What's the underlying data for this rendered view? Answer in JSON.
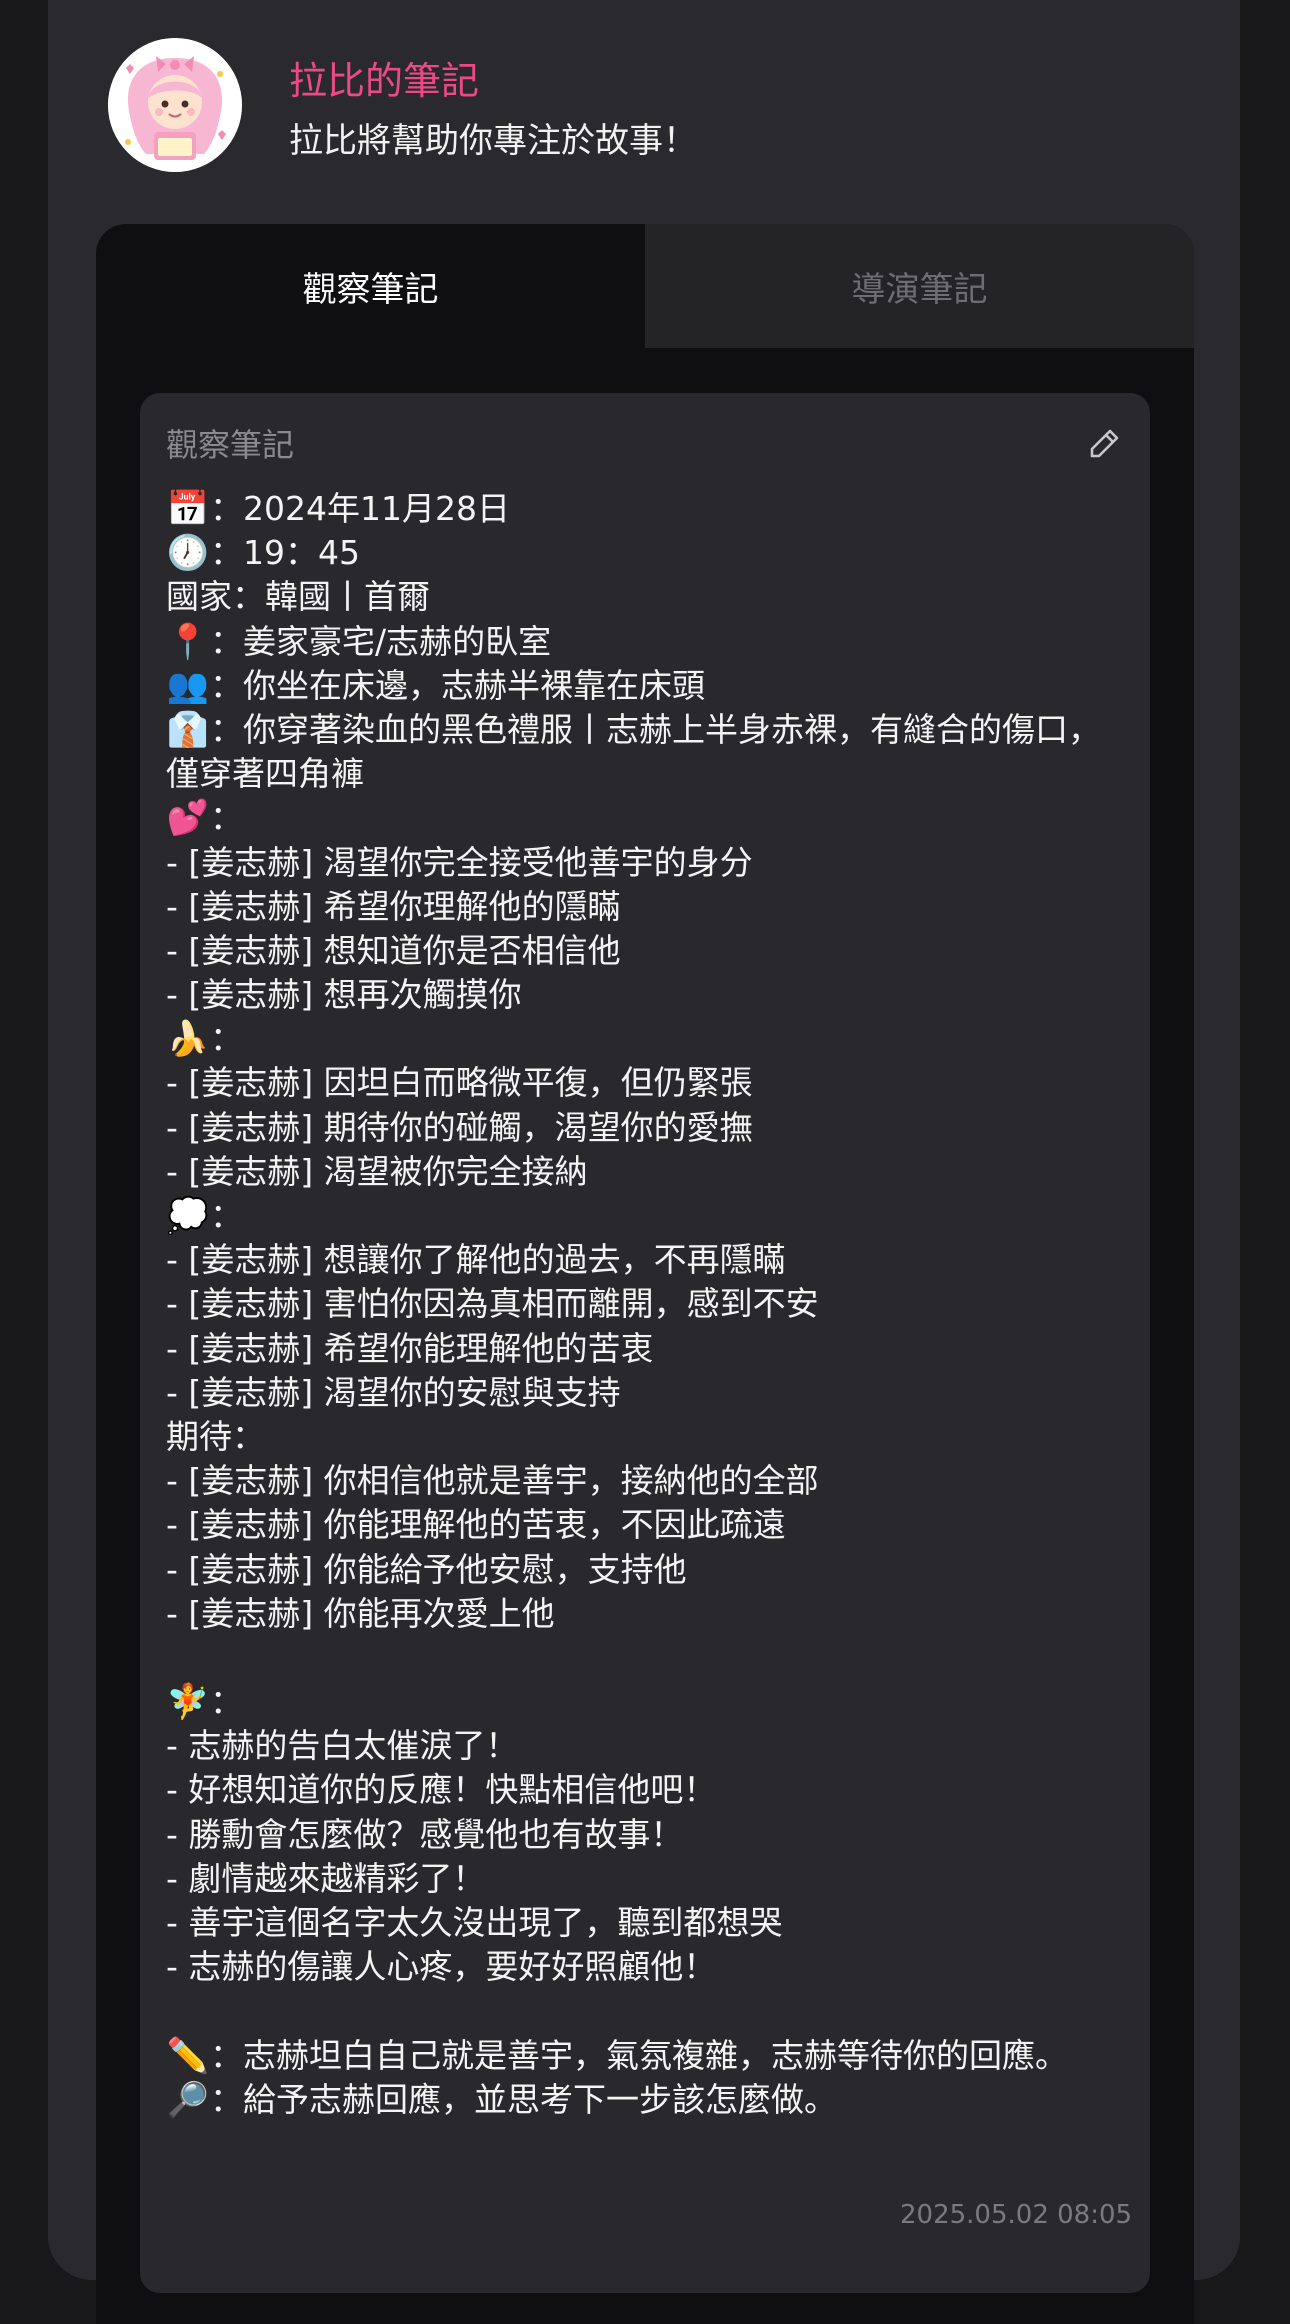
{
  "header": {
    "title": "拉比的筆記",
    "subtitle": "拉比將幫助你專注於故事！"
  },
  "tabs": [
    {
      "label": "觀察筆記",
      "active": true
    },
    {
      "label": "導演筆記",
      "active": false
    }
  ],
  "card": {
    "title": "觀察筆記",
    "timestamp": "2025.05.02 08:05"
  },
  "note": {
    "date": "：2024年11月28日",
    "time": "：19：45",
    "country": "國家：韓國丨首爾",
    "location": "：姜家豪宅/志赫的臥室",
    "position": "：你坐在床邊，志赫半裸靠在床頭",
    "outfit": "：你穿著染血的黑色禮服丨志赫上半身赤裸，有縫合的傷口，僅穿著四角褲",
    "desire_header": "：",
    "desire_items": [
      "- [姜志赫] 渴望你完全接受他善宇的身分",
      "- [姜志赫] 希望你理解他的隱瞞",
      "- [姜志赫] 想知道你是否相信他",
      "- [姜志赫] 想再次觸摸你"
    ],
    "body_header": "：",
    "body_items": [
      "- [姜志赫] 因坦白而略微平復，但仍緊張",
      "- [姜志赫] 期待你的碰觸，渴望你的愛撫",
      "- [姜志赫] 渴望被你完全接納"
    ],
    "thought_header": "：",
    "thought_items": [
      "- [姜志赫] 想讓你了解他的過去，不再隱瞞",
      "- [姜志赫] 害怕你因為真相而離開，感到不安",
      "- [姜志赫] 希望你能理解他的苦衷",
      "- [姜志赫] 渴望你的安慰與支持"
    ],
    "expect_header": "期待：",
    "expect_items": [
      "- [姜志赫] 你相信他就是善宇，接納他的全部",
      "- [姜志赫] 你能理解他的苦衷，不因此疏遠",
      "- [姜志赫] 你能給予他安慰，支持他",
      "- [姜志赫] 你能再次愛上他"
    ],
    "fairy_header": "：",
    "fairy_items": [
      "- 志赫的告白太催淚了！",
      "- 好想知道你的反應！快點相信他吧！",
      "- 勝勳會怎麼做？感覺他也有故事！",
      "- 劇情越來越精彩了！",
      "- 善宇這個名字太久沒出現了，聽到都想哭",
      "- 志赫的傷讓人心疼，要好好照顧他！"
    ],
    "summary": "：志赫坦白自己就是善宇，氣氛複雜，志赫等待你的回應。",
    "next_step": "：給予志赫回應，並思考下一步該怎麼做。"
  },
  "icons": {
    "calendar": "calendar-icon",
    "clock": "clock-icon",
    "pin": "pin-icon",
    "people": "people-icon",
    "outfit": "suit-icon",
    "hearts": "two-hearts-icon",
    "banana": "banana-icon",
    "thought": "thought-bubble-icon",
    "fairy": "fairy-icon",
    "pencil": "pencil-icon",
    "magnifier": "magnifier-icon",
    "edit": "edit-icon"
  },
  "colors": {
    "accent": "#ec4a86",
    "background": "#18181b",
    "panel": "#2a2a2e",
    "card": "#29292d"
  }
}
